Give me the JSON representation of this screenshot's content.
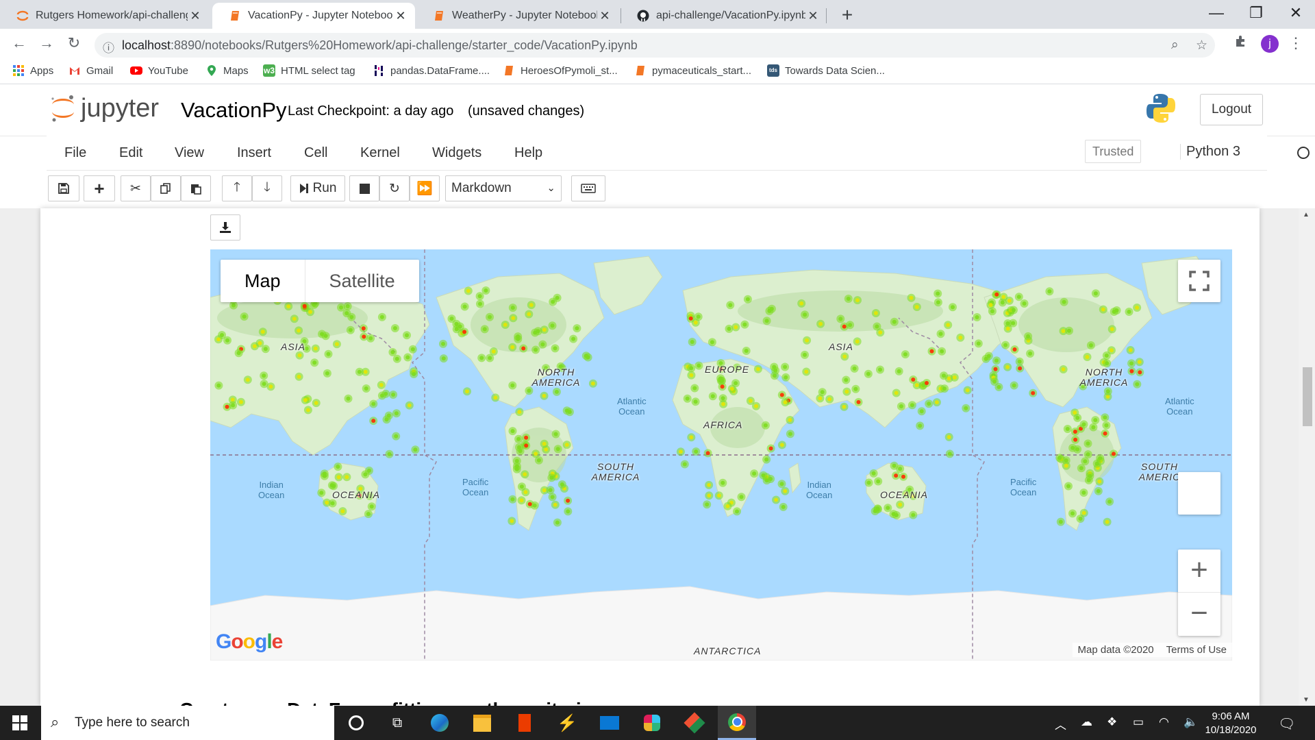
{
  "browser": {
    "tabs": [
      {
        "title": "Rutgers Homework/api-challenge",
        "icon": "jupyter-logo-icon",
        "active": false
      },
      {
        "title": "VacationPy - Jupyter Notebook",
        "icon": "notebook-icon",
        "active": true
      },
      {
        "title": "WeatherPy - Jupyter Notebook",
        "icon": "notebook-icon",
        "active": false
      },
      {
        "title": "api-challenge/VacationPy.ipynb a",
        "icon": "github-icon",
        "active": false
      }
    ],
    "address": {
      "host": "localhost",
      "path": ":8890/notebooks/Rutgers%20Homework/api-challenge/starter_code/VacationPy.ipynb"
    },
    "profile_initial": "j",
    "bookmarks": [
      {
        "label": "Apps",
        "icon": "apps-grid-icon"
      },
      {
        "label": "Gmail",
        "icon": "gmail-icon"
      },
      {
        "label": "YouTube",
        "icon": "youtube-icon"
      },
      {
        "label": "Maps",
        "icon": "maps-icon"
      },
      {
        "label": "HTML select tag",
        "icon": "w3schools-icon"
      },
      {
        "label": "pandas.DataFrame....",
        "icon": "pandas-icon"
      },
      {
        "label": "HeroesOfPymoli_st...",
        "icon": "notebook-icon"
      },
      {
        "label": "pymaceuticals_start...",
        "icon": "notebook-icon"
      },
      {
        "label": "Towards Data Scien...",
        "icon": "tds-icon"
      }
    ]
  },
  "jupyter": {
    "logo_text": "jupyter",
    "notebook_name": "VacationPy",
    "checkpoint": "Last Checkpoint: a day ago",
    "unsaved": "(unsaved changes)",
    "logout": "Logout",
    "menus": [
      "File",
      "Edit",
      "View",
      "Insert",
      "Cell",
      "Kernel",
      "Widgets",
      "Help"
    ],
    "trusted": "Trusted",
    "kernel": "Python 3",
    "run_label": "Run",
    "cell_type": "Markdown"
  },
  "map": {
    "type_options": [
      "Map",
      "Satellite"
    ],
    "selected_type": "Map",
    "continents": [
      "ASIA",
      "NORTH AMERICA",
      "EUROPE",
      "AFRICA",
      "SOUTH AMERICA",
      "OCEANIA",
      "ASIA",
      "NORTH AMERICA",
      "SOUTH AMERIC",
      "OCEANIA",
      "ANTARCTICA"
    ],
    "oceans": [
      "Indian\nOcean",
      "Pacific\nOcean",
      "Atlantic\nOcean",
      "Indian\nOcean",
      "Pacific\nOcean",
      "Atlantic\nOcean"
    ],
    "google": "Google",
    "attribution": "Map data ©2020",
    "terms": "Terms of Use",
    "zoom_in": "+",
    "zoom_out": "−",
    "heat_colors": {
      "low": "#7ddc1f",
      "mid": "#e6e600",
      "high": "#ff2a00"
    }
  },
  "next_heading": "Create new DataFrame fitting weather criteria",
  "taskbar": {
    "search_placeholder": "Type here to search",
    "time": "9:06 AM",
    "date": "10/18/2020"
  }
}
